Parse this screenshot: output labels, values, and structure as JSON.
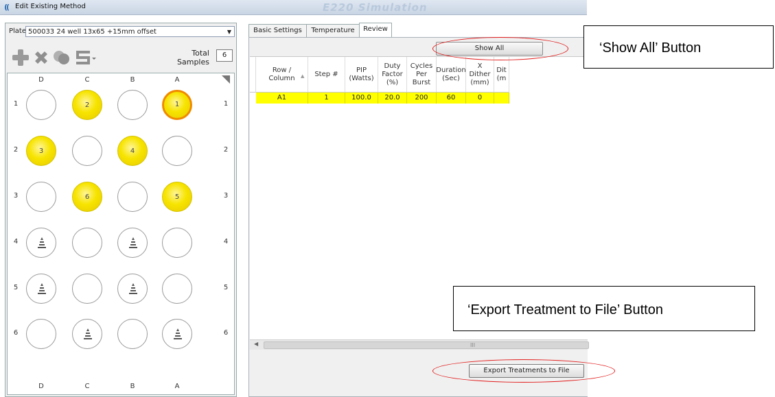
{
  "window": {
    "title": "Edit Existing Method",
    "app_title": "E220 Simulation"
  },
  "left_panel": {
    "plate_label": "Plate",
    "plate_value": "500033 24 well 13x65 +15mm offset",
    "total_samples_label": "Total\nSamples",
    "total_samples_value": "6",
    "column_labels": [
      "D",
      "C",
      "B",
      "A"
    ],
    "row_labels": [
      "1",
      "2",
      "3",
      "4",
      "5",
      "6"
    ]
  },
  "wells": [
    [
      "",
      "2",
      "",
      "1"
    ],
    [
      "3",
      "",
      "4",
      ""
    ],
    [
      "",
      "6",
      "",
      "5"
    ],
    [
      "cone",
      "",
      "cone",
      ""
    ],
    [
      "cone",
      "",
      "cone",
      ""
    ],
    [
      "",
      "cone",
      "",
      "cone"
    ]
  ],
  "tabs": [
    {
      "label": "Basic Settings"
    },
    {
      "label": "Temperature"
    },
    {
      "label": "Review",
      "active": true
    }
  ],
  "review": {
    "show_all_label": "Show All",
    "columns": [
      "Row /\nColumn",
      "Step #",
      "PIP\n(Watts)",
      "Duty\nFactor\n(%)",
      "Cycles\nPer\nBurst",
      "Duration\n(Sec)",
      "X\nDither\n(mm)",
      "Dit\n(m"
    ],
    "rows": [
      [
        "A1",
        "1",
        "100.0",
        "20.0",
        "200",
        "60",
        "0",
        ""
      ]
    ],
    "scroll_grip": "III",
    "export_label": "Export Treatments to File"
  },
  "annotations": {
    "show_all_callout": "‘Show All’ Button",
    "export_callout": "‘Export Treatment to File’ Button",
    "accent_color": "#e21b1b"
  },
  "colors": {
    "filled_well": "#f7e400",
    "selected_well_border": "#f08a00",
    "selected_row": "#ffff00"
  }
}
